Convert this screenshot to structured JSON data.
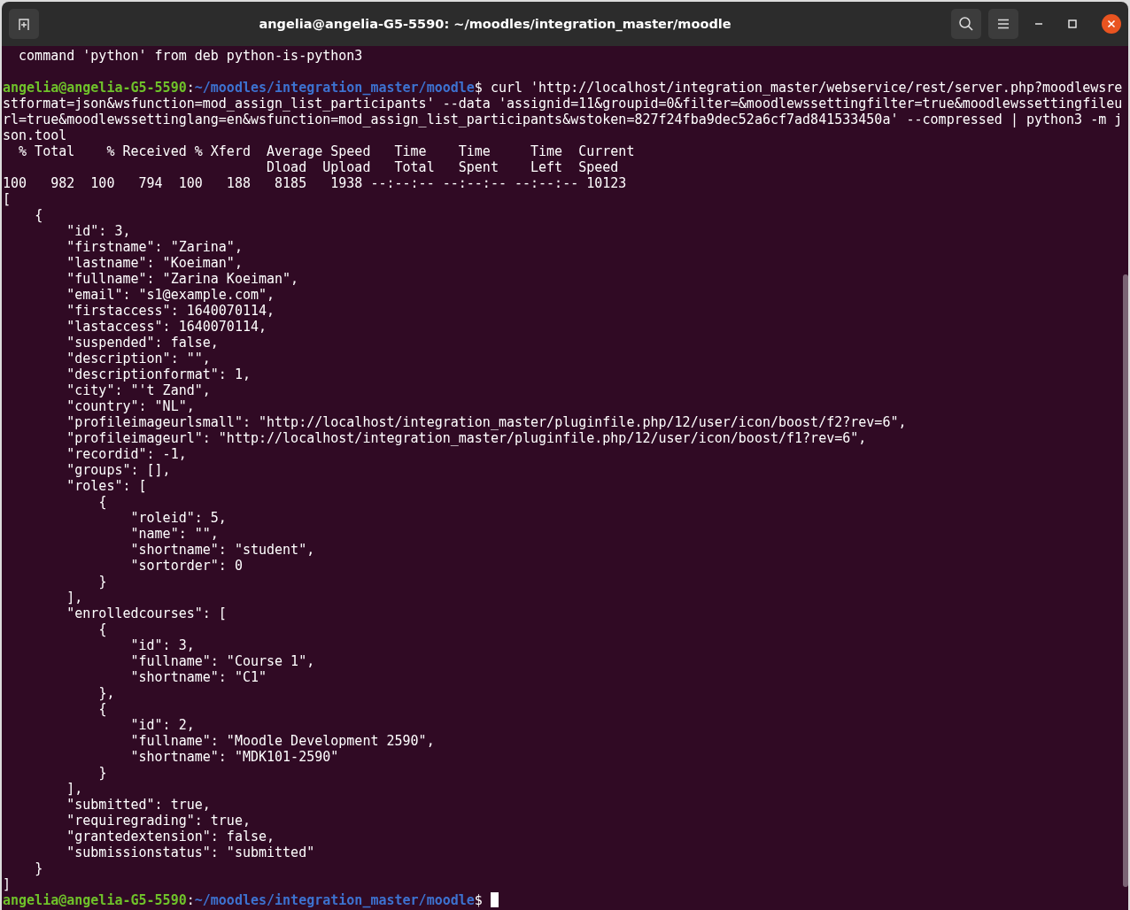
{
  "window": {
    "title": "angelia@angelia-G5-5590: ~/moodles/integration_master/moodle"
  },
  "terminal": {
    "lines": [
      {
        "kind": "output",
        "text": "  command 'python' from deb python-is-python3"
      },
      {
        "kind": "blank"
      },
      {
        "kind": "prompt",
        "user_host": "angelia@angelia-G5-5590",
        "separator": ":",
        "path": "~/moodles/integration_master/moodle",
        "prompt_char": "$",
        "command": "curl 'http://localhost/integration_master/webservice/rest/server.php?moodlewsrestformat=json&wsfunction=mod_assign_list_participants' --data 'assignid=11&groupid=0&filter=&moodlewssettingfilter=true&moodlewssettingfileurl=true&moodlewssettinglang=en&wsfunction=mod_assign_list_participants&wstoken=827f24fba9dec52a6cf7ad841533450a' --compressed | python3 -m json.tool",
        "cursor": false
      },
      {
        "kind": "output",
        "text": "  % Total    % Received % Xferd  Average Speed   Time    Time     Time  Current"
      },
      {
        "kind": "output",
        "text": "                                 Dload  Upload   Total   Spent    Left  Speed"
      },
      {
        "kind": "output",
        "text": "100   982  100   794  100   188   8185   1938 --:--:-- --:--:-- --:--:-- 10123"
      },
      {
        "kind": "output",
        "text": "["
      },
      {
        "kind": "output",
        "text": "    {"
      },
      {
        "kind": "output",
        "text": "        \"id\": 3,"
      },
      {
        "kind": "output",
        "text": "        \"firstname\": \"Zarina\","
      },
      {
        "kind": "output",
        "text": "        \"lastname\": \"Koeiman\","
      },
      {
        "kind": "output",
        "text": "        \"fullname\": \"Zarina Koeiman\","
      },
      {
        "kind": "output",
        "text": "        \"email\": \"s1@example.com\","
      },
      {
        "kind": "output",
        "text": "        \"firstaccess\": 1640070114,"
      },
      {
        "kind": "output",
        "text": "        \"lastaccess\": 1640070114,"
      },
      {
        "kind": "output",
        "text": "        \"suspended\": false,"
      },
      {
        "kind": "output",
        "text": "        \"description\": \"\","
      },
      {
        "kind": "output",
        "text": "        \"descriptionformat\": 1,"
      },
      {
        "kind": "output",
        "text": "        \"city\": \"'t Zand\","
      },
      {
        "kind": "output",
        "text": "        \"country\": \"NL\","
      },
      {
        "kind": "output",
        "text": "        \"profileimageurlsmall\": \"http://localhost/integration_master/pluginfile.php/12/user/icon/boost/f2?rev=6\","
      },
      {
        "kind": "output",
        "text": "        \"profileimageurl\": \"http://localhost/integration_master/pluginfile.php/12/user/icon/boost/f1?rev=6\","
      },
      {
        "kind": "output",
        "text": "        \"recordid\": -1,"
      },
      {
        "kind": "output",
        "text": "        \"groups\": [],"
      },
      {
        "kind": "output",
        "text": "        \"roles\": ["
      },
      {
        "kind": "output",
        "text": "            {"
      },
      {
        "kind": "output",
        "text": "                \"roleid\": 5,"
      },
      {
        "kind": "output",
        "text": "                \"name\": \"\","
      },
      {
        "kind": "output",
        "text": "                \"shortname\": \"student\","
      },
      {
        "kind": "output",
        "text": "                \"sortorder\": 0"
      },
      {
        "kind": "output",
        "text": "            }"
      },
      {
        "kind": "output",
        "text": "        ],"
      },
      {
        "kind": "output",
        "text": "        \"enrolledcourses\": ["
      },
      {
        "kind": "output",
        "text": "            {"
      },
      {
        "kind": "output",
        "text": "                \"id\": 3,"
      },
      {
        "kind": "output",
        "text": "                \"fullname\": \"Course 1\","
      },
      {
        "kind": "output",
        "text": "                \"shortname\": \"C1\""
      },
      {
        "kind": "output",
        "text": "            },"
      },
      {
        "kind": "output",
        "text": "            {"
      },
      {
        "kind": "output",
        "text": "                \"id\": 2,"
      },
      {
        "kind": "output",
        "text": "                \"fullname\": \"Moodle Development 2590\","
      },
      {
        "kind": "output",
        "text": "                \"shortname\": \"MDK101-2590\""
      },
      {
        "kind": "output",
        "text": "            }"
      },
      {
        "kind": "output",
        "text": "        ],"
      },
      {
        "kind": "output",
        "text": "        \"submitted\": true,"
      },
      {
        "kind": "output",
        "text": "        \"requiregrading\": true,"
      },
      {
        "kind": "output",
        "text": "        \"grantedextension\": false,"
      },
      {
        "kind": "output",
        "text": "        \"submissionstatus\": \"submitted\""
      },
      {
        "kind": "output",
        "text": "    }"
      },
      {
        "kind": "output",
        "text": "]"
      },
      {
        "kind": "prompt",
        "user_host": "angelia@angelia-G5-5590",
        "separator": ":",
        "path": "~/moodles/integration_master/moodle",
        "prompt_char": "$",
        "cursor": true
      }
    ]
  }
}
